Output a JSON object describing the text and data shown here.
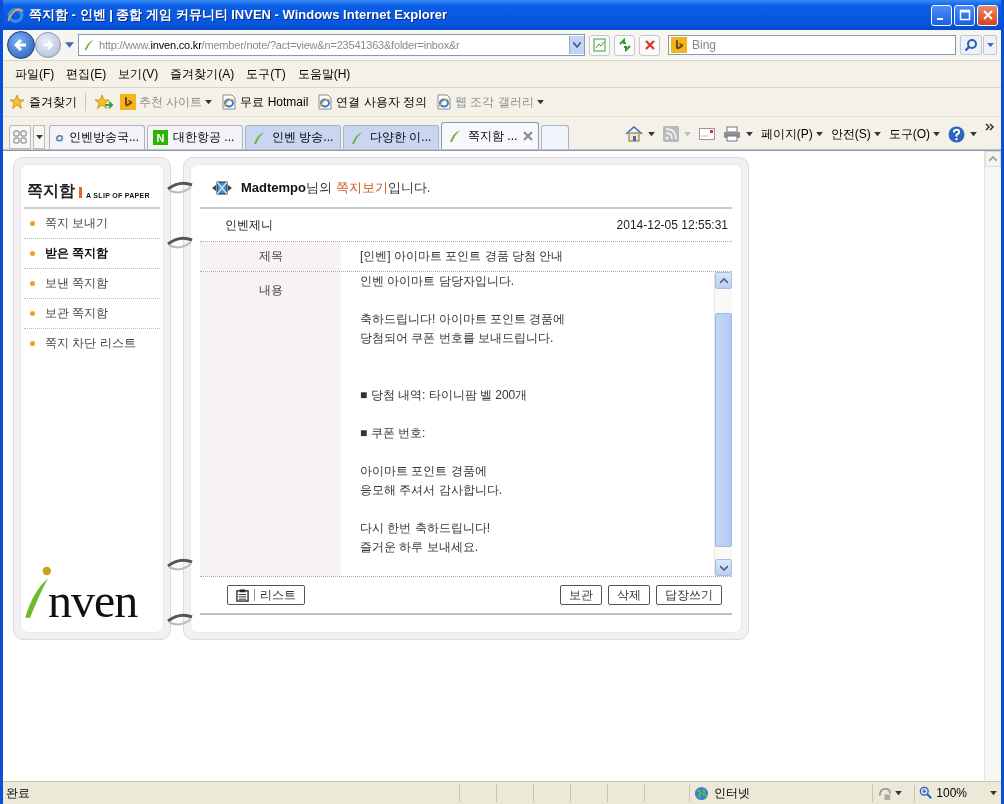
{
  "window": {
    "title": "쪽지함 - 인벤 | 종합 게임 커뮤니티 INVEN - Windows Internet Explorer"
  },
  "address_bar": {
    "url_prefix": "http://www.",
    "url_domain": "inven.co.kr",
    "url_rest": "/member/note/?act=view&n=23541363&folder=inbox&r"
  },
  "search": {
    "placeholder": "Bing"
  },
  "menu_bar": [
    "파일(F)",
    "편집(E)",
    "보기(V)",
    "즐겨찾기(A)",
    "도구(T)",
    "도움말(H)"
  ],
  "favorites_bar": {
    "label": "즐겨찾기",
    "links": [
      {
        "label": "추천 사이트",
        "kind": "suggested",
        "disabled": true,
        "dropdown": true
      },
      {
        "label": "무료 Hotmail",
        "kind": "page",
        "disabled": false,
        "dropdown": false
      },
      {
        "label": "연결 사용자 정의",
        "kind": "page",
        "disabled": false,
        "dropdown": false
      },
      {
        "label": "웹 조각 갤러리",
        "kind": "page",
        "disabled": true,
        "dropdown": true
      }
    ]
  },
  "tabs": [
    {
      "label": "인벤방송국...",
      "kind": "browser",
      "color": "#f4f4f8",
      "selected": false
    },
    {
      "label": "대한항공 ...",
      "kind": "badge",
      "badge": "N",
      "color": "#f4f4f8",
      "selected": false
    },
    {
      "label": "인벤 방송...",
      "kind": "leaf",
      "color": "#c9d6f2",
      "selected": false
    },
    {
      "label": "다양한 이...",
      "kind": "leaf",
      "color": "#c9d6f2",
      "selected": false
    },
    {
      "label": "쪽지함 ...",
      "kind": "leaf",
      "color": "#f6f8fd",
      "selected": true
    }
  ],
  "command_bar": [
    "페이지(P)",
    "안전(S)",
    "도구(O)"
  ],
  "sidebar": {
    "title": "쪽지함",
    "subtitle": "A SLIP OF PAPER",
    "items": [
      {
        "label": "쪽지 보내기",
        "selected": false
      },
      {
        "label": "받은 쪽지함",
        "selected": true
      },
      {
        "label": "보낸 쪽지함",
        "selected": false
      },
      {
        "label": "보관 쪽지함",
        "selected": false
      },
      {
        "label": "쪽지 차단 리스트",
        "selected": false
      }
    ],
    "logo_text": "nven"
  },
  "note": {
    "heading": [
      {
        "text": "Madtempo",
        "kind": "bold"
      },
      {
        "text": "님의 ",
        "kind": "plain"
      },
      {
        "text": "쪽지보기",
        "kind": "highlight"
      },
      {
        "text": "입니다.",
        "kind": "plain"
      }
    ],
    "sender": "인벤제니",
    "date": "2014-12-05 12:55:31",
    "subject_label": "제목",
    "subject": "[인벤] 아이마트 포인트 경품 당첨 안내",
    "content_label": "내용",
    "body": [
      {
        "kind": "text",
        "lines": [
          "인벤 아이마트 담당자입니다."
        ]
      },
      {
        "kind": "text",
        "lines": [
          "축하드립니다! 아이마트 포인트 경품에",
          "당첨되어 쿠폰 번호를 보내드립니다."
        ]
      },
      {
        "kind": "bullet",
        "lines": [
          "■ 당첨 내역: 타이니팜 벨 200개"
        ]
      },
      {
        "kind": "bullet",
        "lines": [
          "■ 쿠폰 번호:"
        ]
      },
      {
        "kind": "text",
        "lines": [
          "아이마트 포인트 경품에",
          "응모해 주셔서 감사합니다."
        ]
      },
      {
        "kind": "text",
        "lines": [
          "다시 한번 축하드립니다!",
          "즐거운 하루 보내세요."
        ]
      }
    ],
    "list_button": "리스트",
    "actions": [
      "보관",
      "삭제",
      "답장쓰기"
    ]
  },
  "status_bar": {
    "text": "완료",
    "zone": "인터넷",
    "zoom": "100%"
  }
}
